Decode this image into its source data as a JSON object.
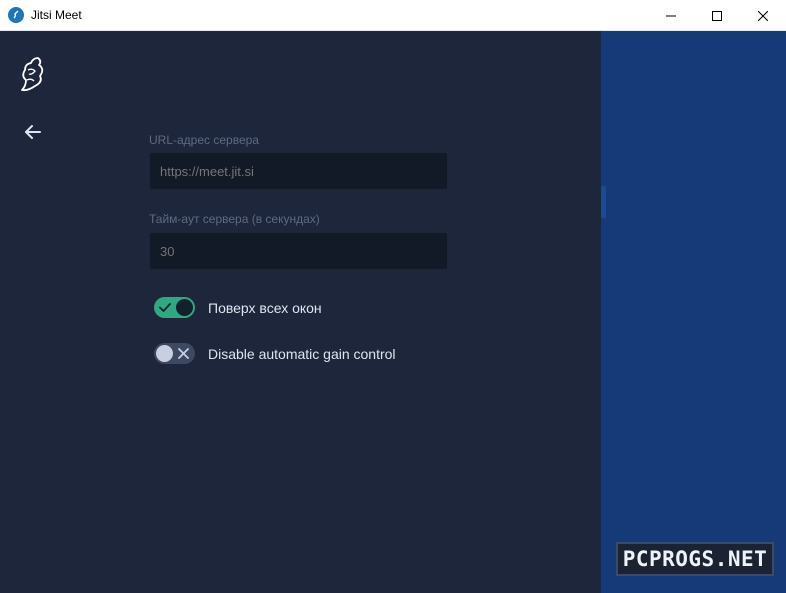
{
  "window": {
    "title": "Jitsi Meet",
    "icons": {
      "app": "jitsi-icon",
      "minimize": "minimize-icon",
      "maximize": "maximize-icon",
      "close": "close-icon"
    }
  },
  "sidebar": {
    "logo_icon": "jitsi-logo-icon",
    "back_icon": "arrow-left-icon"
  },
  "settings": {
    "server_url": {
      "label": "URL-адрес сервера",
      "placeholder": "https://meet.jit.si",
      "value": ""
    },
    "server_timeout": {
      "label": "Тайм-аут сервера (в секундах)",
      "placeholder": "30",
      "value": ""
    },
    "always_on_top": {
      "label": "Поверх всех окон",
      "enabled": true
    },
    "disable_agc": {
      "label": "Disable automatic gain control",
      "enabled": false
    }
  },
  "watermark": {
    "text": "PCPROGS.NET"
  },
  "colors": {
    "background": "#1d263a",
    "right_panel": "#163a78",
    "toggle_on": "#2fa981",
    "toggle_off": "#3d4963",
    "label_text": "#5c6b84",
    "primary_text": "#dfe4ee"
  }
}
